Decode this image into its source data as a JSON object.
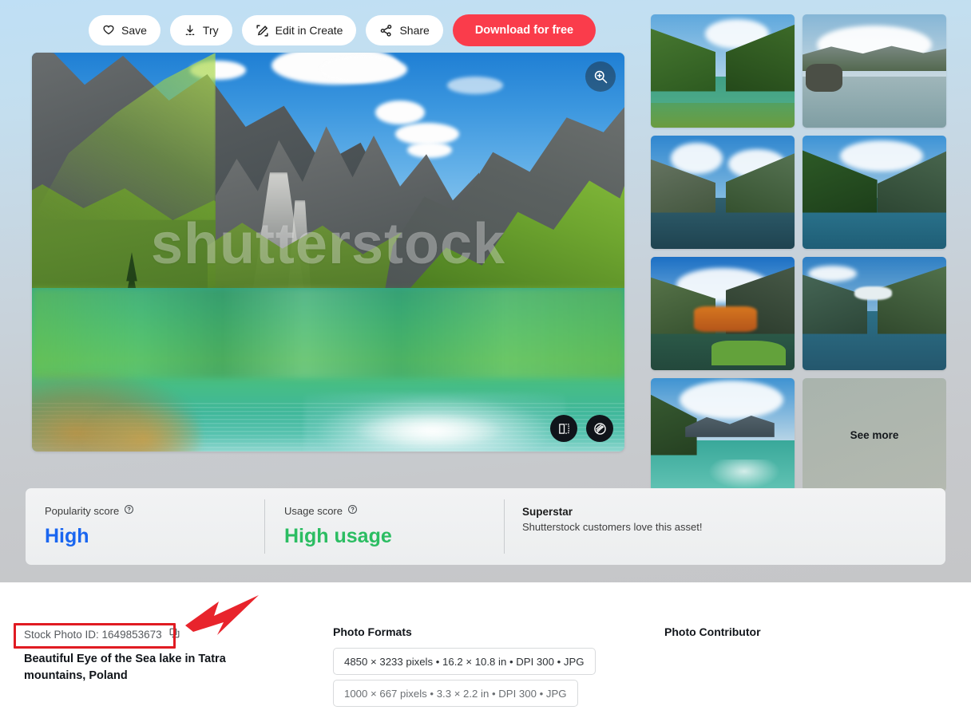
{
  "toolbar": {
    "buttons": [
      {
        "label": "Save",
        "icon": "heart-icon"
      },
      {
        "label": "Try",
        "icon": "download-try-icon"
      },
      {
        "label": "Edit in Create",
        "icon": "edit-pencil-icon"
      },
      {
        "label": "Share",
        "icon": "share-nodes-icon"
      }
    ],
    "download_label": "Download for free",
    "download_color": "#fa3c4b"
  },
  "hero_image": {
    "watermark": "shutterstock",
    "zoom_icon": "magnifier-plus-icon",
    "action_icons": [
      "crop-resize-icon",
      "similar-pattern-icon"
    ]
  },
  "rail": {
    "see_more_label": "See more",
    "thumbnails": [
      {
        "name": "alpine-river-valley-green-forest"
      },
      {
        "name": "mountain-lake-mirror-reflection-rock"
      },
      {
        "name": "blue-lake-cloudy-peaks"
      },
      {
        "name": "forested-canyon-river-bend"
      },
      {
        "name": "autumn-lake-orange-trees"
      },
      {
        "name": "glacier-lake-steep-cliffs"
      },
      {
        "name": "turquoise-lake-with-pines"
      }
    ]
  },
  "scores": {
    "popularity": {
      "label": "Popularity score",
      "help_icon": "question-circle-icon",
      "value": "High",
      "color": "#1a66f0"
    },
    "usage": {
      "label": "Usage score",
      "help_icon": "question-circle-icon",
      "value": "High usage",
      "color": "#2bbd62"
    },
    "superstar": {
      "title": "Superstar",
      "subtitle": "Shutterstock customers love this asset!"
    }
  },
  "details": {
    "stock_id_label": "Stock Photo ID: 1649853673",
    "copy_icon": "copy-icon",
    "asset_title": "Beautiful Eye of the Sea lake in Tatra mountains, Poland",
    "formats_heading": "Photo Formats",
    "formats": [
      "4850 × 3233 pixels • 16.2 × 10.8 in • DPI 300 • JPG",
      "1000 × 667 pixels • 3.3 × 2.2 in • DPI 300 • JPG"
    ],
    "contributor_heading": "Photo Contributor"
  },
  "annotations": {
    "highlight_color": "#e01b22",
    "arrow_color": "#e8242c"
  }
}
